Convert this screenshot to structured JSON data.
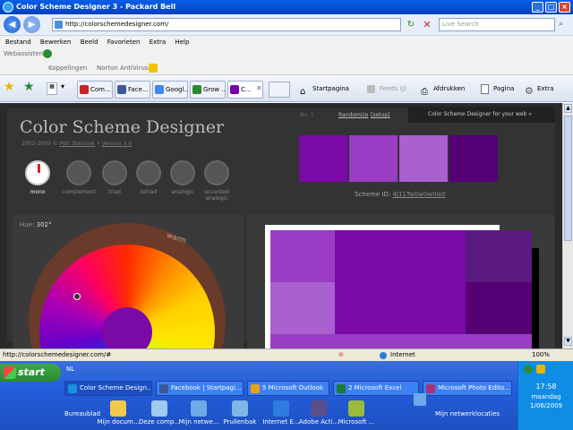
{
  "window": {
    "title": "Color Scheme Designer 3 - Packard Bell"
  },
  "address": {
    "url": "http://colorschemedesigner.com/",
    "search_placeholder": "Live Search"
  },
  "menu": [
    "Bestand",
    "Bewerken",
    "Beeld",
    "Favorieten",
    "Extra",
    "Help"
  ],
  "links": {
    "webassistent": "Webassistent",
    "koppelingen": "Koppelingen",
    "norton": "Norton AntiVirus"
  },
  "tabs": [
    {
      "label": "Com...",
      "color": "#cc2222"
    },
    {
      "label": "Face...",
      "color": "#3b5998"
    },
    {
      "label": "Googl...",
      "color": "#4285f4"
    },
    {
      "label": "Grow ...",
      "color": "#2a8a2f"
    },
    {
      "label": "C...",
      "color": "#7700aa"
    }
  ],
  "toolbar": {
    "home": "Startpagina",
    "feeds": "Feeds (J)",
    "print": "Afdrukken",
    "page": "Pagina",
    "extra": "Extra"
  },
  "app": {
    "title": "Color Scheme Designer",
    "copyright_pre": "2002-2009 © ",
    "author": "Petr Stanicek",
    "version": "Version 3.0",
    "nav": {
      "no": "No. 1",
      "randomize": "Randomize",
      "setup": "[setup]",
      "tagline": "Color Scheme Designer for your web »"
    },
    "modes": [
      "mono",
      "complement",
      "triad",
      "tetrad",
      "analogic",
      "accented analogic"
    ],
    "active_mode": "mono",
    "scheme_label": "Scheme ID:",
    "scheme_id": "4J11Tw0w0w0w0",
    "hue_label": "Hue:",
    "hue_value": "302°",
    "warm_label": "warm",
    "swatches": [
      "#7a0aa8",
      "#9a3cc4",
      "#a861ce",
      "#540074"
    ]
  },
  "status": {
    "url": "http://colorschemedesigner.com/#",
    "zone": "Internet",
    "zoom": "100%"
  },
  "taskbar": {
    "start": "start",
    "lang": "NL",
    "tasks": [
      {
        "label": "Color Scheme Design...",
        "color": "#1b90e0"
      },
      {
        "label": "Facebook | Startpagi...",
        "color": "#3b5998"
      },
      {
        "label": "5 Microsoft Outlook",
        "color": "#e8a317"
      },
      {
        "label": "2 Microsoft Excel",
        "color": "#1d7a3a"
      },
      {
        "label": "Microsoft Photo Edito...",
        "color": "#aa3377"
      }
    ],
    "quick": [
      {
        "label": "Bureaublad",
        "color": "#3a6fd8"
      },
      {
        "label": "Mijn docum...",
        "color": "#f2c94c"
      },
      {
        "label": "Deze comp...",
        "color": "#9ec9f0"
      },
      {
        "label": "Mijn netwe...",
        "color": "#6fa9e8"
      },
      {
        "label": "Prullenbak",
        "color": "#7fb6e6"
      },
      {
        "label": "Internet E...",
        "color": "#2f7ce0"
      },
      {
        "label": "Adobe Acti...",
        "color": "#5a4f8a"
      },
      {
        "label": "Microsoft ...",
        "color": "#9dbb3a"
      },
      {
        "label": "Mijn netwerklocaties",
        "color": "#6fa9e8"
      }
    ],
    "clock": {
      "time": "17:58",
      "day": "maandag",
      "date": "1/06/2009"
    }
  }
}
